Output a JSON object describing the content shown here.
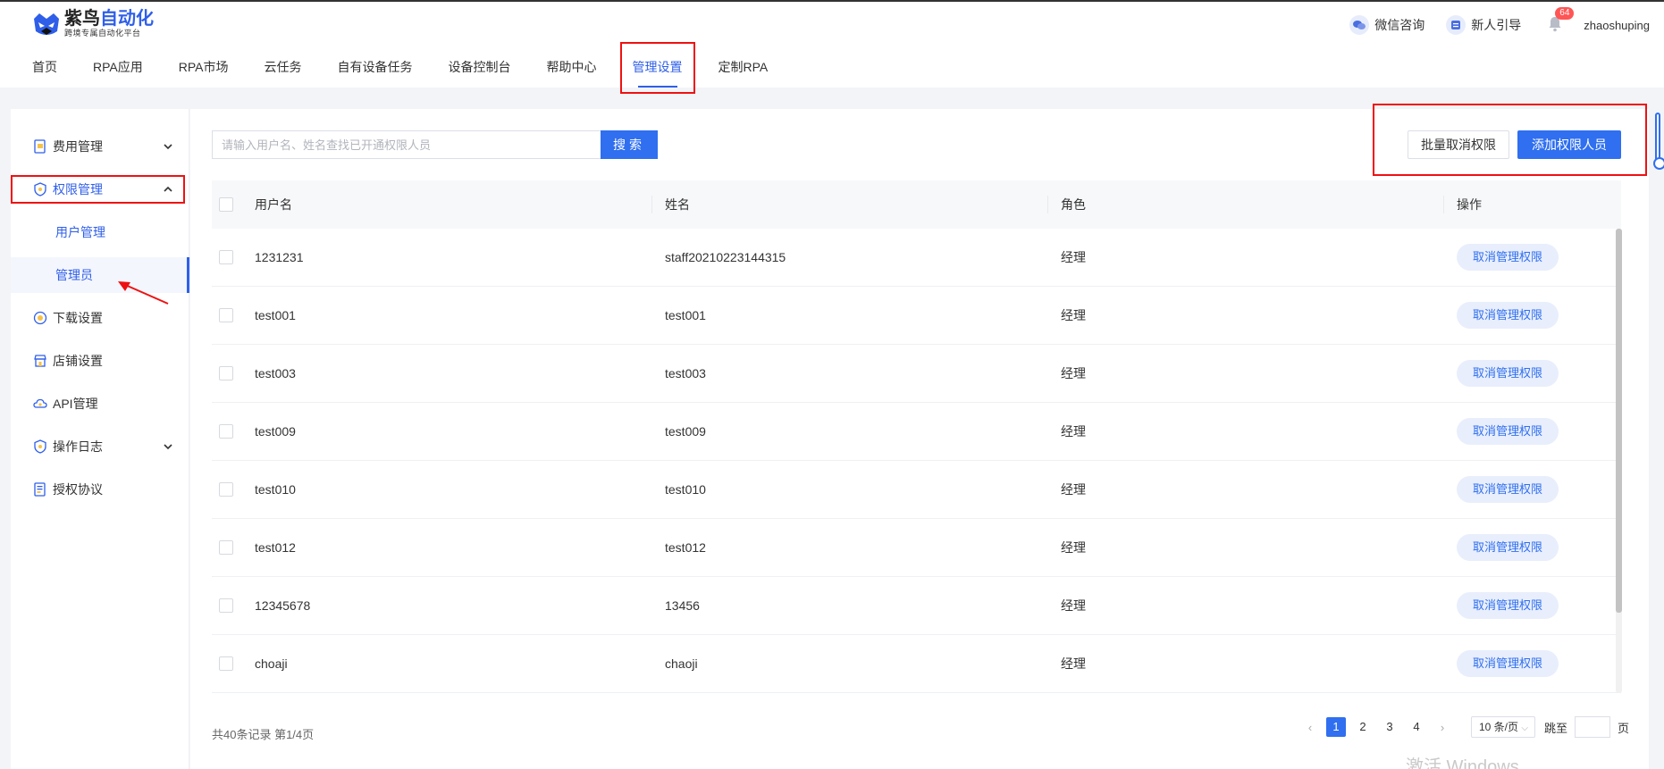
{
  "brand": {
    "name_part1": "紫鸟",
    "name_part2": "自动化",
    "tagline": "跨境专属自动化平台"
  },
  "nav": [
    {
      "label": "首页"
    },
    {
      "label": "RPA应用"
    },
    {
      "label": "RPA市场"
    },
    {
      "label": "云任务"
    },
    {
      "label": "自有设备任务"
    },
    {
      "label": "设备控制台"
    },
    {
      "label": "帮助中心"
    },
    {
      "label": "管理设置",
      "active": true
    },
    {
      "label": "定制RPA"
    }
  ],
  "header_right": {
    "wechat": "微信咨询",
    "guide": "新人引导",
    "notifications": "64",
    "username": "zhaoshuping"
  },
  "sidebar": {
    "fee": "费用管理",
    "perm": "权限管理",
    "perm_sub_users": "用户管理",
    "perm_sub_admin": "管理员",
    "download": "下载设置",
    "shop": "店铺设置",
    "api": "API管理",
    "log": "操作日志",
    "auth": "授权协议"
  },
  "toolbar": {
    "search_placeholder": "请输入用户名、姓名查找已开通权限人员",
    "search_label": "搜索",
    "batch_cancel_label": "批量取消权限",
    "add_label": "添加权限人员"
  },
  "table": {
    "headers": {
      "username": "用户名",
      "name": "姓名",
      "role": "角色",
      "action": "操作"
    },
    "action_label": "取消管理权限",
    "rows": [
      {
        "username": "1231231",
        "name": "staff20210223144315",
        "role": "经理"
      },
      {
        "username": "test001",
        "name": "test001",
        "role": "经理"
      },
      {
        "username": "test003",
        "name": "test003",
        "role": "经理"
      },
      {
        "username": "test009",
        "name": "test009",
        "role": "经理"
      },
      {
        "username": "test010",
        "name": "test010",
        "role": "经理"
      },
      {
        "username": "test012",
        "name": "test012",
        "role": "经理"
      },
      {
        "username": "12345678",
        "name": "13456",
        "role": "经理"
      },
      {
        "username": "choaji",
        "name": "chaoji",
        "role": "经理"
      }
    ]
  },
  "pagination": {
    "summary": "共40条记录 第1/4页",
    "pages": [
      "1",
      "2",
      "3",
      "4"
    ],
    "page_size": "10 条/页",
    "jump_label": "跳至",
    "page_suffix": "页"
  },
  "watermark": "激活 Windows"
}
